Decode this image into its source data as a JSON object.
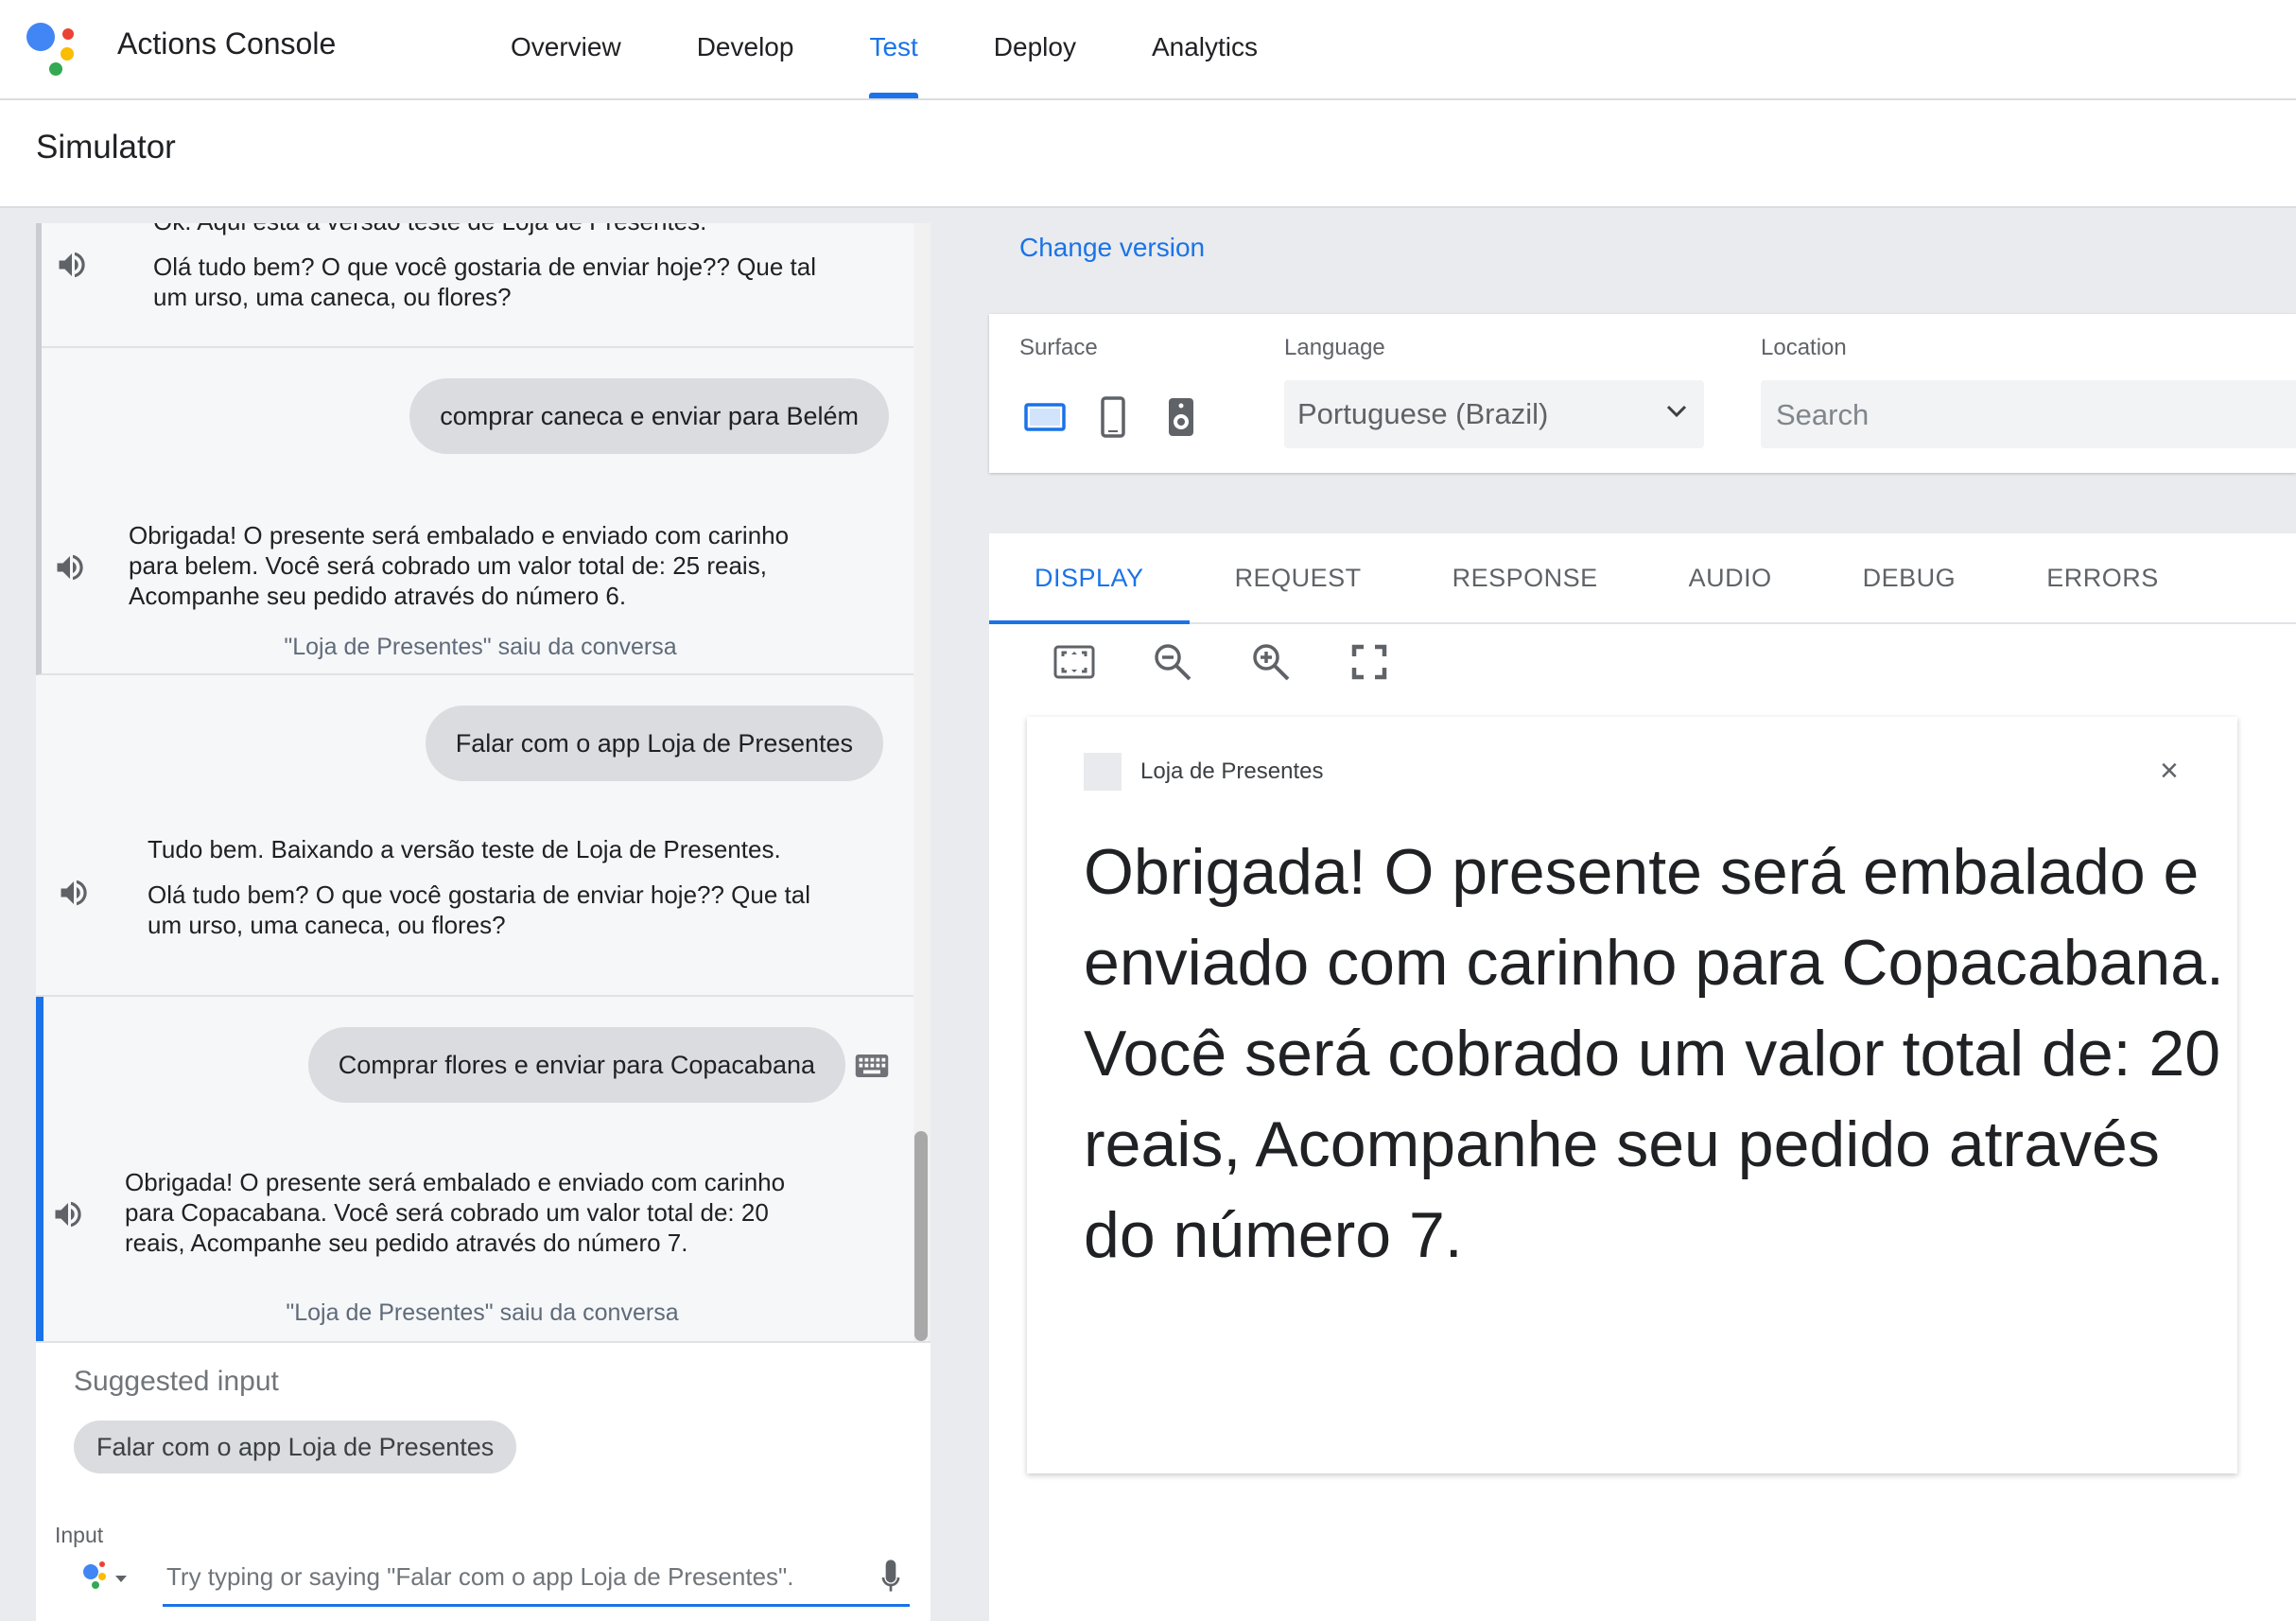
{
  "header": {
    "app_title": "Actions Console",
    "nav": [
      "Overview",
      "Develop",
      "Test",
      "Deploy",
      "Analytics"
    ],
    "active_nav": "Test"
  },
  "subheader": {
    "title": "Simulator"
  },
  "chat": {
    "turn1": {
      "bot_line1": "Ok. Aqui está a versão teste de Loja de Presentes.",
      "bot_line2a": "Olá tudo bem? O que você gostaria de enviar hoje?? Que tal",
      "bot_line2b": "um urso, uma caneca, ou flores?"
    },
    "turn2": {
      "user": "comprar caneca e enviar para Belém",
      "bot_a": "Obrigada! O presente será embalado e enviado com carinho",
      "bot_b": "para belem. Você será cobrado um valor total de: 25 reais,",
      "bot_c": "Acompanhe seu pedido através do número 6.",
      "note": "\"Loja de Presentes\" saiu da conversa"
    },
    "turn3": {
      "user": "Falar com o app Loja de Presentes",
      "bot_line1": "Tudo bem. Baixando a versão teste de Loja de Presentes.",
      "bot_line2a": "Olá tudo bem? O que você gostaria de enviar hoje?? Que tal",
      "bot_line2b": "um urso, uma caneca, ou flores?"
    },
    "turn4": {
      "user": "Comprar flores e enviar para Copacabana",
      "bot_a": "Obrigada! O presente será embalado e enviado com carinho",
      "bot_b": "para Copacabana. Você será cobrado um valor total de: 20",
      "bot_c": "reais, Acompanhe seu pedido através do número 7.",
      "note": "\"Loja de Presentes\" saiu da conversa"
    }
  },
  "suggest": {
    "title": "Suggested input",
    "chip": "Falar com o app Loja de Presentes"
  },
  "input": {
    "label": "Input",
    "placeholder": "Try typing or saying \"Falar com o app Loja de Presentes\"."
  },
  "settings": {
    "change_version": "Change version",
    "surface_label": "Surface",
    "language_label": "Language",
    "language_value": "Portuguese (Brazil)",
    "location_label": "Location",
    "location_placeholder": "Search"
  },
  "output": {
    "tabs": [
      "DISPLAY",
      "REQUEST",
      "RESPONSE",
      "AUDIO",
      "DEBUG",
      "ERRORS"
    ],
    "active_tab": "DISPLAY",
    "card_app": "Loja de Presentes",
    "card_close": "×",
    "card_text": "Obrigada! O presente será embalado e enviado com carinho para Copacabana. Você será cobrado um valor total de: 20 reais, Acompanhe seu pedido através do número 7."
  },
  "colors": {
    "accent": "#1a73e8",
    "bubble": "#dadcdf",
    "panel_bg": "#e9ebee"
  }
}
